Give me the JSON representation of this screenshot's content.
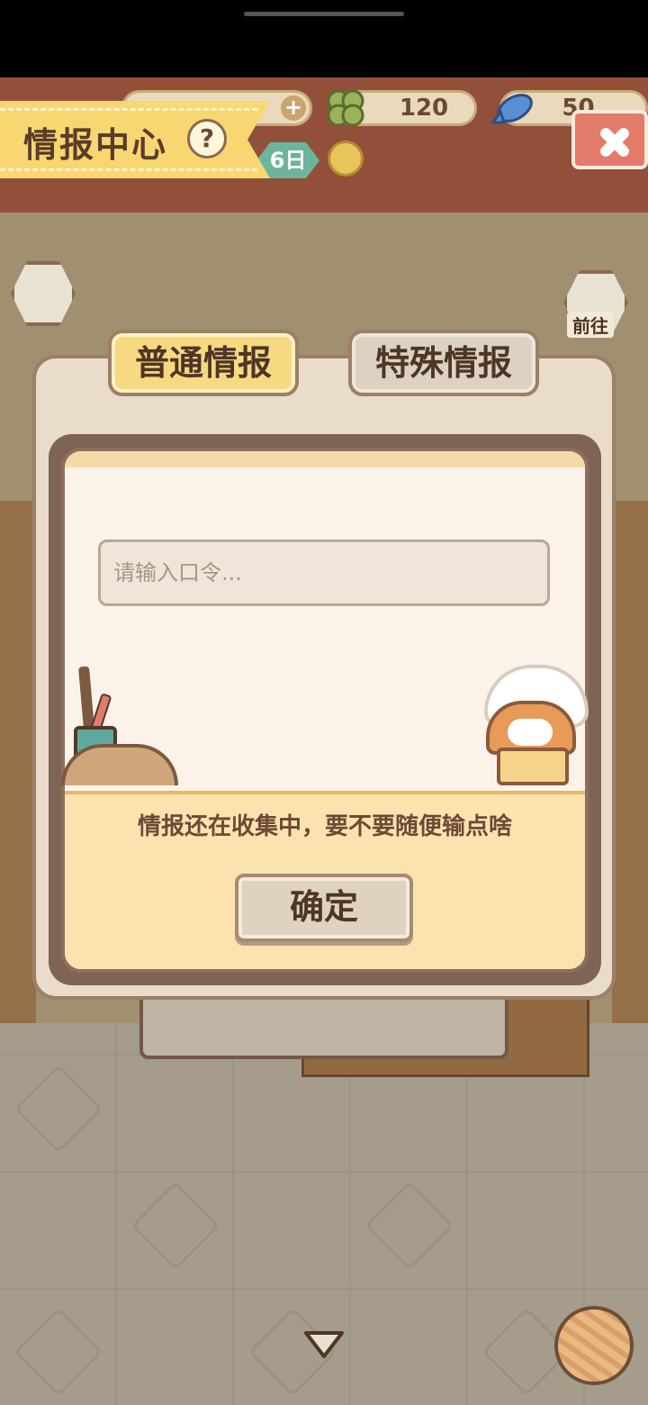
{
  "header": {
    "title": "情报中心",
    "help_symbol": "?",
    "resources": {
      "coins": "",
      "clover": "120",
      "fish": "50"
    },
    "day_label": "6日"
  },
  "side": {
    "goto_label": "前往"
  },
  "tabs": [
    {
      "label": "普通情报",
      "active": true
    },
    {
      "label": "特殊情报",
      "active": false
    }
  ],
  "form": {
    "code_placeholder": "请输入口令...",
    "code_value": "",
    "hint": "情报还在收集中，要不要随便输点啥",
    "confirm_label": "确定"
  },
  "colors": {
    "accent": "#f7d982",
    "close": "#e27b6a",
    "text": "#4e3626"
  }
}
